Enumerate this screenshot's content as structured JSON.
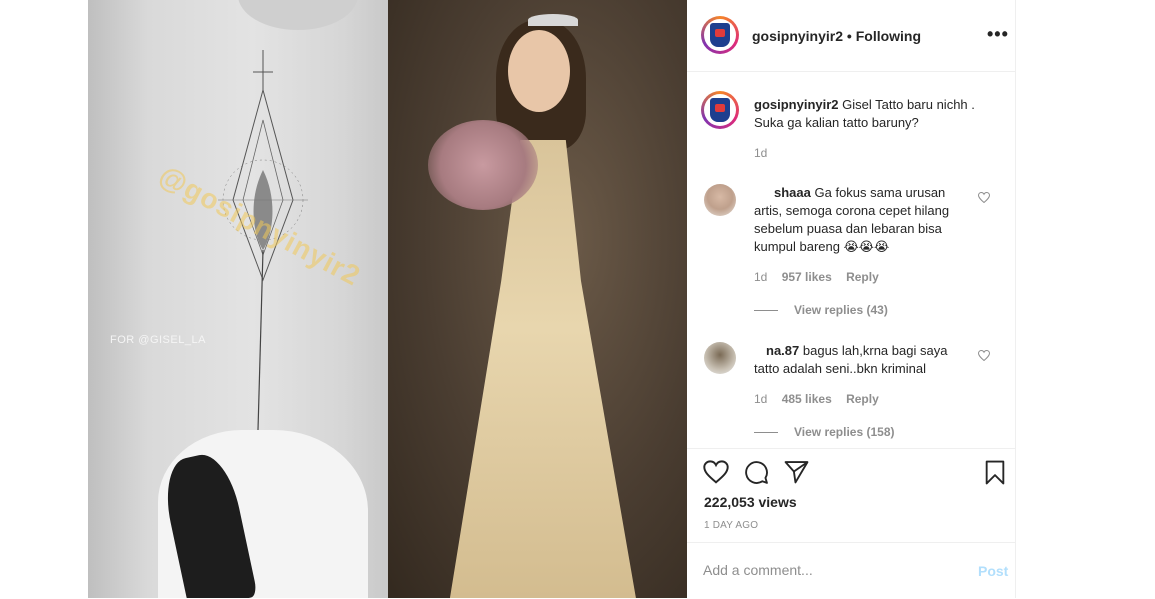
{
  "media": {
    "left_photo": {
      "watermark": "@gosipnyinyir2",
      "credit": "FOR @GISEL_LA"
    }
  },
  "post": {
    "header": {
      "username": "gosipnyinyir2",
      "separator": "•",
      "follow_status": "Following",
      "more_label": "•••"
    },
    "caption": {
      "username": "gosipnyinyir2",
      "text": "Gisel Tatto baru nichh . Suka ga kalian tatto baruny?",
      "time": "1d"
    },
    "comments": [
      {
        "username": "shaaa",
        "text": "Ga fokus sama urusan artis, semoga corona cepet hilang sebelum puasa dan lebaran bisa kumpul bareng 😭😭😭",
        "time": "1d",
        "likes": "957 likes",
        "reply_label": "Reply",
        "view_replies": "View replies (43)"
      },
      {
        "username": "na.87",
        "text": "bagus lah,krna bagi saya tatto adalah seni..bkn kriminal",
        "time": "1d",
        "likes": "485 likes",
        "reply_label": "Reply",
        "view_replies": "View replies (158)"
      }
    ],
    "views": "222,053 views",
    "posted_ago": "1 DAY AGO",
    "comment_box": {
      "placeholder": "Add a comment...",
      "post_label": "Post"
    }
  },
  "icons": {
    "like": "heart-icon",
    "comment": "comment-icon",
    "share": "share-icon",
    "save": "bookmark-icon",
    "comment_like": "small-heart-icon"
  },
  "colors": {
    "text_primary": "#262626",
    "text_secondary": "#8e8e8e",
    "border": "#efefef",
    "post_button_disabled": "#b2dffc"
  }
}
